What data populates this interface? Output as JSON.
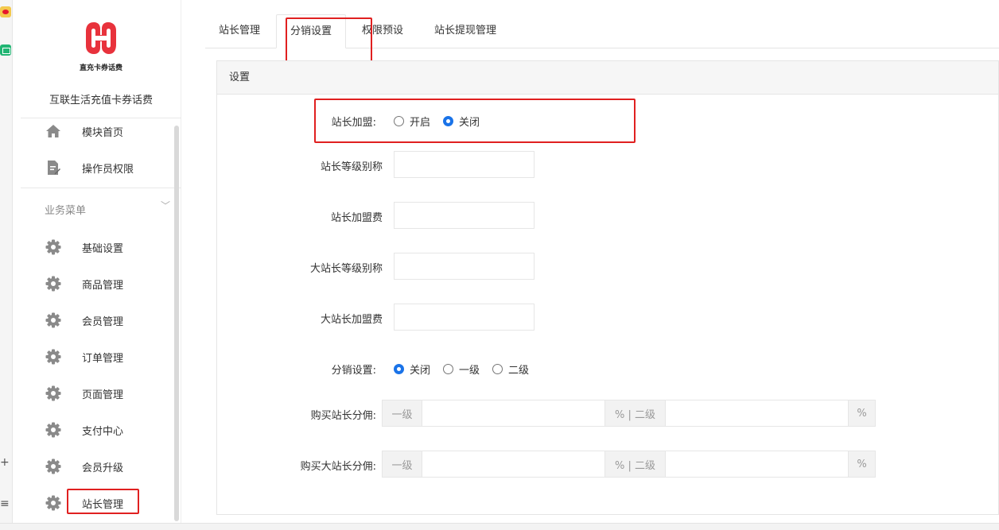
{
  "brand": {
    "logo_caption": "直充卡券话费",
    "app_name": "互联生活充值卡券话费",
    "logo_color": "#e8323c"
  },
  "sidebar": {
    "top_items": [
      {
        "label": "模块首页",
        "icon": "home-icon"
      },
      {
        "label": "操作员权限",
        "icon": "document-edit-icon"
      }
    ],
    "section_title": "业务菜单",
    "items": [
      {
        "label": "基础设置",
        "icon": "gear-icon"
      },
      {
        "label": "商品管理",
        "icon": "gear-icon"
      },
      {
        "label": "会员管理",
        "icon": "gear-icon"
      },
      {
        "label": "订单管理",
        "icon": "gear-icon"
      },
      {
        "label": "页面管理",
        "icon": "gear-icon"
      },
      {
        "label": "支付中心",
        "icon": "gear-icon"
      },
      {
        "label": "会员升级",
        "icon": "gear-icon"
      },
      {
        "label": "站长管理",
        "icon": "gear-icon"
      }
    ],
    "active_item": "站长管理"
  },
  "tabs": [
    {
      "label": "站长管理",
      "active": false
    },
    {
      "label": "分销设置",
      "active": true
    },
    {
      "label": "权限预设",
      "active": false
    },
    {
      "label": "站长提现管理",
      "active": false
    }
  ],
  "panel": {
    "title": "设置",
    "join": {
      "label": "站长加盟:",
      "options": [
        "开启",
        "关闭"
      ],
      "selected": "关闭"
    },
    "fields": [
      {
        "label": "站长等级别称",
        "value": ""
      },
      {
        "label": "站长加盟费",
        "value": ""
      },
      {
        "label": "大站长等级别称",
        "value": ""
      },
      {
        "label": "大站长加盟费",
        "value": ""
      }
    ],
    "distribution": {
      "label": "分销设置:",
      "options": [
        "关闭",
        "一级",
        "二级"
      ],
      "selected": "关闭"
    },
    "commissions": [
      {
        "label": "购买站长分佣:",
        "level1_prefix": "一级",
        "mid_addon": "% | 二级",
        "suffix": "%",
        "level1_value": "",
        "level2_value": ""
      },
      {
        "label": "购买大站长分佣:",
        "level1_prefix": "一级",
        "mid_addon": "% | 二级",
        "suffix": "%",
        "level1_value": "",
        "level2_value": ""
      }
    ]
  },
  "colors": {
    "highlight_border": "#e02020",
    "radio_selected": "#1a73e8"
  }
}
